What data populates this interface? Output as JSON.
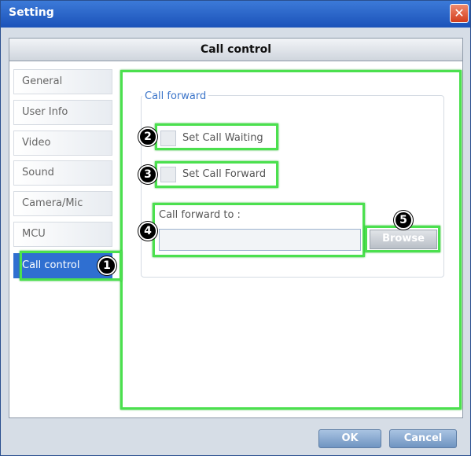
{
  "window": {
    "title": "Setting",
    "close_glyph": "✕"
  },
  "header": {
    "title": "Call control"
  },
  "sidebar": {
    "items": [
      {
        "label": "General"
      },
      {
        "label": "User Info"
      },
      {
        "label": "Video"
      },
      {
        "label": "Sound"
      },
      {
        "label": "Camera/Mic"
      },
      {
        "label": "MCU"
      },
      {
        "label": "Call control"
      }
    ],
    "active_index": 6
  },
  "call_forward": {
    "group_title": "Call forward",
    "set_call_waiting_label": "Set Call Waiting",
    "set_call_forward_label": "Set Call Forward",
    "call_forward_to_label": "Call forward to :",
    "call_forward_to_value": "",
    "browse_label": "Browse"
  },
  "annotations": {
    "badges": [
      "1",
      "2",
      "3",
      "4",
      "5"
    ],
    "highlight_color": "#4be04e"
  },
  "footer": {
    "ok_label": "OK",
    "cancel_label": "Cancel"
  },
  "colors": {
    "titlebar": "#1b52b9",
    "active_nav": "#2f6fd1",
    "group_title": "#3c75c9"
  }
}
